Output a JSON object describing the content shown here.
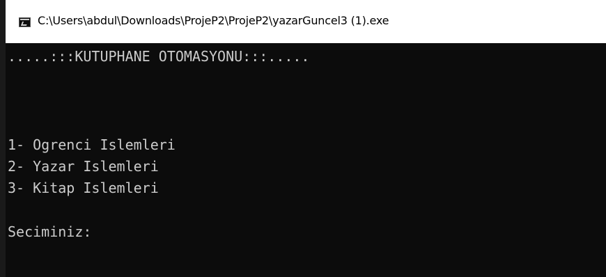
{
  "window": {
    "title": "C:\\Users\\abdul\\Downloads\\ProjeP2\\ProjeP2\\yazarGuncel3 (1).exe",
    "icon": "console-app-icon"
  },
  "console": {
    "header": ".....:::KUTUPHANE OTOMASYONU:::.....",
    "menu": [
      "1- Ogrenci Islemleri",
      "2- Yazar Islemleri",
      "3- Kitap Islemleri"
    ],
    "prompt": "Seciminiz:"
  },
  "colors": {
    "background": "#0c0c0c",
    "text": "#cccccc",
    "titlebar": "#ffffff"
  }
}
